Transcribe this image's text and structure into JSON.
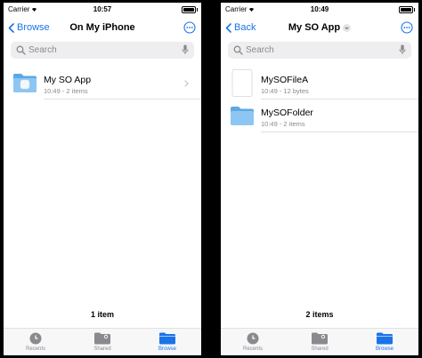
{
  "colors": {
    "accent": "#1a73e8",
    "folder": "#5aa8e6",
    "folder_light": "#8dc6f2"
  },
  "left": {
    "status": {
      "carrier": "Carrier",
      "time": "10:57"
    },
    "nav": {
      "back_label": "Browse",
      "title": "On My iPhone"
    },
    "search": {
      "placeholder": "Search"
    },
    "items": [
      {
        "name": "My SO App",
        "meta": "10:49 - 2 items",
        "icon": "app-folder-icon"
      }
    ],
    "count": "1 item"
  },
  "right": {
    "status": {
      "carrier": "Carrier",
      "time": "10:49"
    },
    "nav": {
      "back_label": "Back",
      "title": "My SO App"
    },
    "search": {
      "placeholder": "Search"
    },
    "items": [
      {
        "name": "MySOFileA",
        "meta": "10:49 - 12 bytes",
        "icon": "document-icon"
      },
      {
        "name": "MySOFolder",
        "meta": "10:49 - 2 items",
        "icon": "folder-icon"
      }
    ],
    "count": "2 items"
  },
  "tabbar": {
    "tabs": [
      {
        "label": "Recents",
        "icon": "clock-icon",
        "active": false
      },
      {
        "label": "Shared",
        "icon": "shared-folder-icon",
        "active": false
      },
      {
        "label": "Browse",
        "icon": "folder-icon",
        "active": true
      }
    ]
  }
}
